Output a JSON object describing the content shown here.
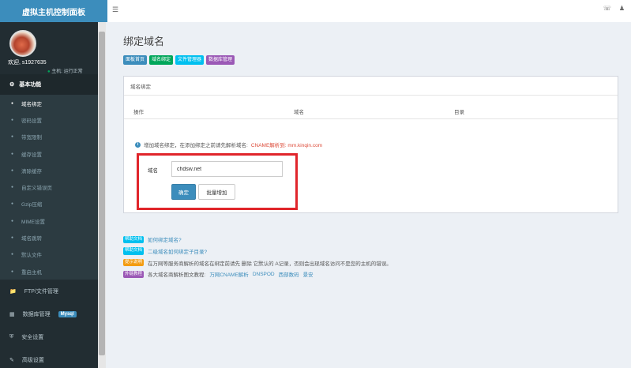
{
  "header": {
    "logo": "虚拟主机控制面板",
    "menu_icon": "hamburger-icon",
    "right_icons": [
      "headset-icon",
      "user-icon"
    ]
  },
  "sidebar": {
    "welcome": "欢迎, s1927635",
    "host_status": "主机: 运行正常",
    "section_title": "基本功能",
    "items": [
      {
        "label": "域名绑定",
        "active": true
      },
      {
        "label": "密码设置"
      },
      {
        "label": "带宽限制"
      },
      {
        "label": "缓存设置"
      },
      {
        "label": "清除缓存"
      },
      {
        "label": "自定义错误页"
      },
      {
        "label": "Gzip压缩"
      },
      {
        "label": "MIME设置"
      },
      {
        "label": "域名跳转"
      },
      {
        "label": "默认文件"
      },
      {
        "label": "重启主机"
      }
    ],
    "ftp": "FTP/文件管理",
    "database": "数据库管理",
    "mysql_badge": "Mysql",
    "security": "安全设置",
    "advanced": "高级设置"
  },
  "main": {
    "title": "绑定域名",
    "tags": [
      {
        "label": "面板首页",
        "color": "#3c8dbc"
      },
      {
        "label": "域名绑定",
        "color": "#00a65a"
      },
      {
        "label": "文件管理器",
        "color": "#00c0ef"
      },
      {
        "label": "数据库管理",
        "color": "#9b59b6"
      }
    ],
    "panel_title": "域名绑定",
    "columns": [
      "操作",
      "域名",
      "目录"
    ],
    "info_prefix": "增加域名绑定，在添加绑定之前请先解析域名:",
    "info_red": "CNAME解析到: mm.kinqin.com",
    "field_label": "域名",
    "domain_value": "chdsw.net",
    "confirm_btn": "确定",
    "batch_btn": "批量增加"
  },
  "help": [
    {
      "tag": "帮助文档",
      "tag_color": "#00c0ef",
      "text": "如何绑定域名?",
      "is_link": true
    },
    {
      "tag": "帮助文档",
      "tag_color": "#00c0ef",
      "text": "二级域名如何绑定子目录?",
      "is_link": true
    },
    {
      "tag": "提示说明",
      "tag_color": "#f39c12",
      "text": "在万网等服务商解析的域名在绑定前请先 删除 它默认的 A记录，否则会出现域名访问不是您的主机的错误。",
      "is_link": false
    },
    {
      "tag": "外链教程",
      "tag_color": "#9b59b6",
      "text_prefix": "各大域名商解析图文教程:",
      "links": [
        "万网CNAME解析",
        "DNSPOD",
        "西部数码",
        "景安"
      ]
    }
  ]
}
